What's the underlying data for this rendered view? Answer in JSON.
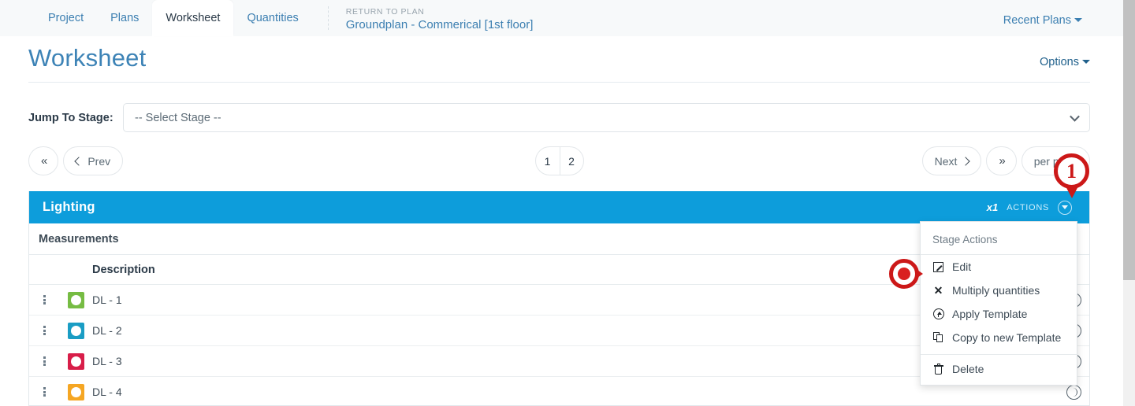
{
  "nav": {
    "tabs": [
      {
        "label": "Project",
        "active": false
      },
      {
        "label": "Plans",
        "active": false
      },
      {
        "label": "Worksheet",
        "active": true
      },
      {
        "label": "Quantities",
        "active": false
      }
    ],
    "return_kicker": "RETURN TO PLAN",
    "plan_name": "Groundplan - Commerical [1st floor]",
    "recent_plans": "Recent Plans"
  },
  "header": {
    "title": "Worksheet",
    "options": "Options"
  },
  "stage_select": {
    "label": "Jump To Stage:",
    "value": "-- Select Stage --",
    "chevron_icon": "chevron-down-icon"
  },
  "pagination": {
    "first_icon": "double-chevron-left-icon",
    "prev_label": "Prev",
    "pages": [
      "1",
      "2"
    ],
    "current_page": "1",
    "next_label": "Next",
    "last_icon": "double-chevron-right-icon",
    "per_page_label": "per page"
  },
  "stage": {
    "name": "Lighting",
    "multiplier": "x1",
    "actions_label": "ACTIONS",
    "actions_toggle_icon": "chevron-down-circle-icon",
    "header_color": "#0d9ddb",
    "measurements_label": "Measurements",
    "columns": [
      "Description"
    ],
    "rows": [
      {
        "description": "DL - 1",
        "color": "#76bc43",
        "handle_icon": "drag-handle-icon",
        "row_icon": "clock-icon"
      },
      {
        "description": "DL - 2",
        "color": "#1a9dc4",
        "handle_icon": "drag-handle-icon",
        "row_icon": "clock-icon"
      },
      {
        "description": "DL - 3",
        "color": "#d81e49",
        "handle_icon": "drag-handle-icon",
        "row_icon": "clock-icon"
      },
      {
        "description": "DL - 4",
        "color": "#f5a623",
        "handle_icon": "drag-handle-icon",
        "row_icon": "clock-icon"
      }
    ]
  },
  "menu": {
    "title": "Stage Actions",
    "items": [
      {
        "label": "Edit",
        "icon": "edit-icon"
      },
      {
        "label": "Multiply quantities",
        "icon": "multiply-x-icon"
      },
      {
        "label": "Apply Template",
        "icon": "arrow-up-circle-icon"
      },
      {
        "label": "Copy to new Template",
        "icon": "copy-icon"
      }
    ],
    "danger_item": {
      "label": "Delete",
      "icon": "trash-icon"
    }
  },
  "annotations": {
    "step_marker": "1",
    "marker_color": "#cc1818"
  }
}
